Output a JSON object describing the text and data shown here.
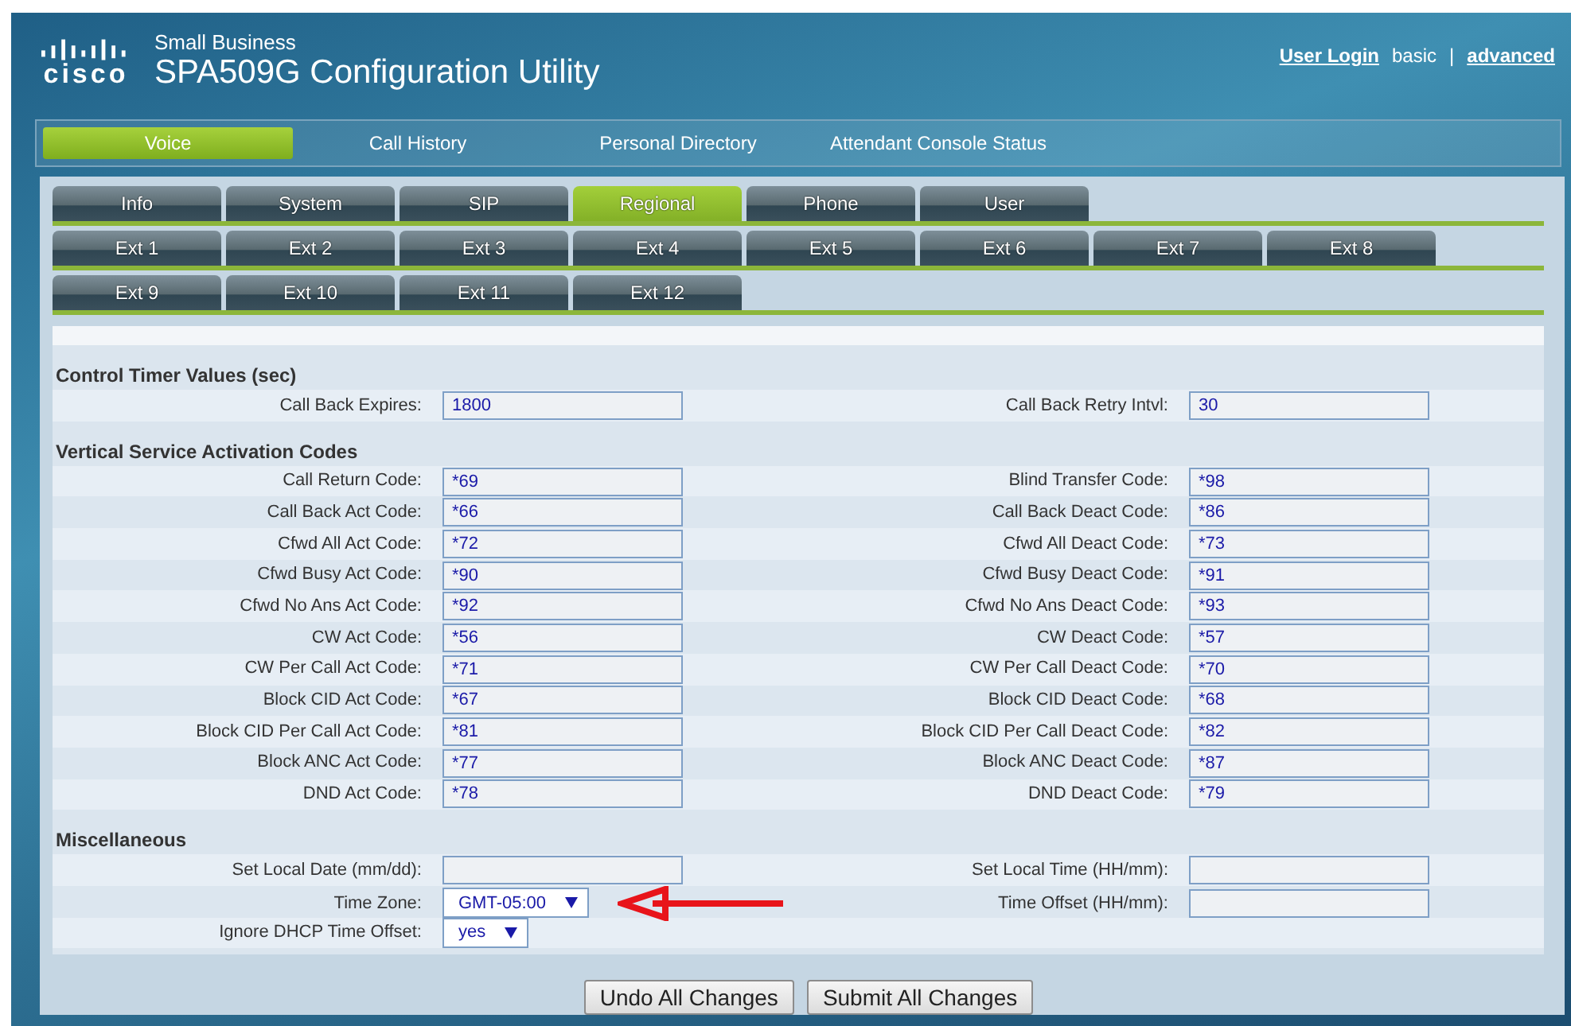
{
  "header": {
    "logo_text": "cisco",
    "brand": "Small Business",
    "title": "SPA509G Configuration Utility",
    "links": [
      {
        "text": "User Login",
        "link": true
      },
      {
        "text": "basic",
        "link": false
      },
      {
        "text": "|",
        "link": false
      },
      {
        "text": "advanced",
        "link": true
      }
    ]
  },
  "main_nav": [
    {
      "label": "Voice",
      "selected": true
    },
    {
      "label": "Call History",
      "selected": false
    },
    {
      "label": "Personal Directory",
      "selected": false
    },
    {
      "label": "Attendant Console Status",
      "selected": false
    }
  ],
  "tab_rows": [
    [
      {
        "label": "Info",
        "selected": false
      },
      {
        "label": "System",
        "selected": false
      },
      {
        "label": "SIP",
        "selected": false
      },
      {
        "label": "Regional",
        "selected": true
      },
      {
        "label": "Phone",
        "selected": false
      },
      {
        "label": "User",
        "selected": false
      }
    ],
    [
      {
        "label": "Ext 1",
        "selected": false
      },
      {
        "label": "Ext 2",
        "selected": false
      },
      {
        "label": "Ext 3",
        "selected": false
      },
      {
        "label": "Ext 4",
        "selected": false
      },
      {
        "label": "Ext 5",
        "selected": false
      },
      {
        "label": "Ext 6",
        "selected": false
      },
      {
        "label": "Ext 7",
        "selected": false
      },
      {
        "label": "Ext 8",
        "selected": false
      }
    ],
    [
      {
        "label": "Ext 9",
        "selected": false
      },
      {
        "label": "Ext 10",
        "selected": false
      },
      {
        "label": "Ext 11",
        "selected": false
      },
      {
        "label": "Ext 12",
        "selected": false
      }
    ]
  ],
  "sections": [
    {
      "title": "Control Timer Values (sec)",
      "rows": [
        {
          "left": {
            "label": "Call Back Expires:",
            "kind": "text",
            "value": "1800"
          },
          "right": {
            "label": "Call Back Retry Intvl:",
            "kind": "text",
            "value": "30"
          }
        }
      ]
    },
    {
      "title": "Vertical Service Activation Codes",
      "rows": [
        {
          "left": {
            "label": "Call Return Code:",
            "kind": "text",
            "value": "*69"
          },
          "right": {
            "label": "Blind Transfer Code:",
            "kind": "text",
            "value": "*98"
          }
        },
        {
          "left": {
            "label": "Call Back Act Code:",
            "kind": "text",
            "value": "*66"
          },
          "right": {
            "label": "Call Back Deact Code:",
            "kind": "text",
            "value": "*86"
          }
        },
        {
          "left": {
            "label": "Cfwd All Act Code:",
            "kind": "text",
            "value": "*72"
          },
          "right": {
            "label": "Cfwd All Deact Code:",
            "kind": "text",
            "value": "*73"
          }
        },
        {
          "left": {
            "label": "Cfwd Busy Act Code:",
            "kind": "text",
            "value": "*90"
          },
          "right": {
            "label": "Cfwd Busy Deact Code:",
            "kind": "text",
            "value": "*91"
          }
        },
        {
          "left": {
            "label": "Cfwd No Ans Act Code:",
            "kind": "text",
            "value": "*92"
          },
          "right": {
            "label": "Cfwd No Ans Deact Code:",
            "kind": "text",
            "value": "*93"
          }
        },
        {
          "left": {
            "label": "CW Act Code:",
            "kind": "text",
            "value": "*56"
          },
          "right": {
            "label": "CW Deact Code:",
            "kind": "text",
            "value": "*57"
          }
        },
        {
          "left": {
            "label": "CW Per Call Act Code:",
            "kind": "text",
            "value": "*71"
          },
          "right": {
            "label": "CW Per Call Deact Code:",
            "kind": "text",
            "value": "*70"
          }
        },
        {
          "left": {
            "label": "Block CID Act Code:",
            "kind": "text",
            "value": "*67"
          },
          "right": {
            "label": "Block CID Deact Code:",
            "kind": "text",
            "value": "*68"
          }
        },
        {
          "left": {
            "label": "Block CID Per Call Act Code:",
            "kind": "text",
            "value": "*81"
          },
          "right": {
            "label": "Block CID Per Call Deact Code:",
            "kind": "text",
            "value": "*82"
          }
        },
        {
          "left": {
            "label": "Block ANC Act Code:",
            "kind": "text",
            "value": "*77"
          },
          "right": {
            "label": "Block ANC Deact Code:",
            "kind": "text",
            "value": "*87"
          }
        },
        {
          "left": {
            "label": "DND Act Code:",
            "kind": "text",
            "value": "*78"
          },
          "right": {
            "label": "DND Deact Code:",
            "kind": "text",
            "value": "*79"
          }
        }
      ]
    },
    {
      "title": "Miscellaneous",
      "rows": [
        {
          "left": {
            "label": "Set Local Date (mm/dd):",
            "kind": "text"
          },
          "right": {
            "label": "Set Local Time (HH/mm):",
            "kind": "text"
          }
        },
        {
          "left": {
            "label": "Time Zone:",
            "kind": "select",
            "value": "GMT-05:00",
            "arrow": true
          },
          "right": {
            "label": "Time Offset (HH/mm):",
            "kind": "text"
          }
        },
        {
          "left": {
            "label": "Ignore DHCP Time Offset:",
            "kind": "select",
            "value": "yes"
          }
        }
      ]
    }
  ],
  "buttons": [
    "Undo All Changes",
    "Submit All Changes"
  ]
}
